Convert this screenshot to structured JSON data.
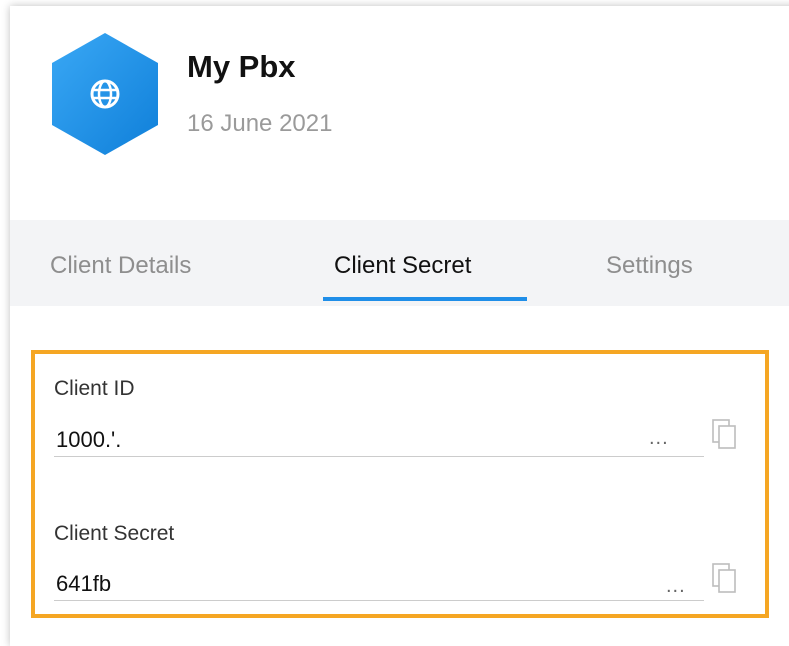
{
  "app": {
    "name": "My Pbx",
    "date": "16 June 2021",
    "icon": "globe-icon",
    "icon_color": "#1f8ee8"
  },
  "tabs": [
    {
      "label": "Client Details",
      "active": false
    },
    {
      "label": "Client Secret",
      "active": true
    },
    {
      "label": "Settings",
      "active": false
    }
  ],
  "fields": {
    "client_id": {
      "label": "Client ID",
      "value": "1000.'.",
      "ellipsis": "...",
      "copy_icon": "copy-icon"
    },
    "client_secret": {
      "label": "Client Secret",
      "value": "641fb",
      "ellipsis": "...",
      "copy_icon": "copy-icon"
    }
  },
  "colors": {
    "accent": "#1f8ee8",
    "highlight_border": "#f5a623",
    "tab_bar_bg": "#f3f4f6"
  }
}
